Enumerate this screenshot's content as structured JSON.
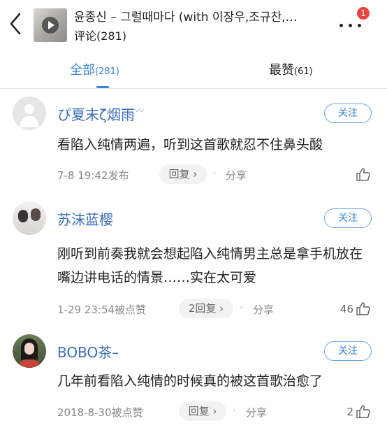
{
  "header": {
    "song_title": "윤종신 – 그럴때마다 (with 이장우,조규찬,…",
    "comment_count_label": "评论(281)",
    "notification_badge": "1",
    "back_icon": "chevron-left-icon",
    "more_icon": "more-dots-icon"
  },
  "tabs": [
    {
      "label": "全部",
      "count": "(281)",
      "active": true
    },
    {
      "label": "最赞",
      "count": "(61)",
      "active": false
    }
  ],
  "comments": [
    {
      "nickname": "ぴ夏末ζ烟雨",
      "nickname_suffix": "〰",
      "follow_label": "关注",
      "content": "看陷入纯情两遍，听到这首歌就忍不住鼻头酸",
      "time": "7-8 19:42发布",
      "reply_label": "回复 ›",
      "share_label": "分享",
      "like_count": ""
    },
    {
      "nickname": "苏沫蓝樱",
      "follow_label": "关注",
      "content": "刚听到前奏我就会想起陷入纯情男主总是拿手机放在嘴边讲电话的情景……实在太可爱",
      "time": "1-29 23:54被点赞",
      "reply_label": "2回复 ›",
      "share_label": "分享",
      "like_count": "46"
    },
    {
      "nickname": "BOBO茶–",
      "follow_label": "关注",
      "content": "几年前看陷入纯情的时候真的被这首歌治愈了",
      "time": "2018-8-30被点赞",
      "reply_label": "回复 ›",
      "share_label": "分享",
      "like_count": "2"
    }
  ],
  "colors": {
    "accent": "#3a85d6",
    "nickname": "#3a6fb7",
    "badge": "#e8453c"
  }
}
